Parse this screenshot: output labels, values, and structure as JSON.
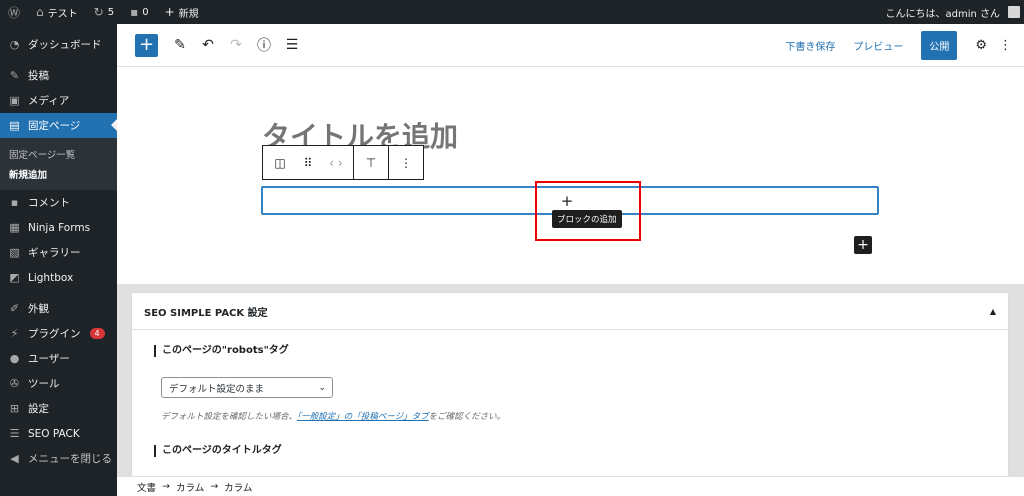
{
  "adminbar": {
    "site_name": "テスト",
    "updates_count": "5",
    "comments_count": "0",
    "new_label": "新規",
    "greeting": "こんにちは、admin さん"
  },
  "sidebar": {
    "items": [
      {
        "label": "ダッシュボード",
        "icon": "dashboard-icon"
      },
      {
        "label": "投稿",
        "icon": "pin-icon"
      },
      {
        "label": "メディア",
        "icon": "media-icon"
      },
      {
        "label": "固定ページ",
        "icon": "page-icon"
      },
      {
        "label": "コメント",
        "icon": "comment-icon"
      },
      {
        "label": "Ninja Forms",
        "icon": "form-icon"
      },
      {
        "label": "ギャラリー",
        "icon": "gallery-icon"
      },
      {
        "label": "Lightbox",
        "icon": "lightbox-icon"
      },
      {
        "label": "外観",
        "icon": "brush-icon"
      },
      {
        "label": "プラグイン",
        "icon": "plugin-icon",
        "badge": "4"
      },
      {
        "label": "ユーザー",
        "icon": "user-icon"
      },
      {
        "label": "ツール",
        "icon": "wrench-icon"
      },
      {
        "label": "設定",
        "icon": "settings-icon"
      },
      {
        "label": "SEO PACK",
        "icon": "list-icon"
      },
      {
        "label": "メニューを閉じる",
        "icon": "collapse-icon"
      }
    ],
    "submenu": [
      "固定ページ一覧",
      "新規追加"
    ]
  },
  "header": {
    "save_draft": "下書き保存",
    "preview": "プレビュー",
    "publish": "公開"
  },
  "editor": {
    "title_placeholder": "タイトルを追加",
    "tooltip": "ブロックの追加"
  },
  "metabox": {
    "title": "SEO SIMPLE PACK 設定",
    "robots_label": "このページの\"robots\"タグ",
    "robots_value": "デフォルト設定のまま",
    "desc_prefix": "デフォルト設定を確認したい場合、",
    "desc_link": "「一般設定」の「投稿ページ」タブ",
    "desc_suffix": "をご確認ください。",
    "title_tag_label": "このページのタイトルタグ"
  },
  "footer": {
    "crumbs": [
      "文書",
      "カラム",
      "カラム"
    ]
  },
  "colors": {
    "accent": "#2271b1",
    "sidebar_bg": "#1d2327",
    "highlight_box": "#ee0000"
  }
}
